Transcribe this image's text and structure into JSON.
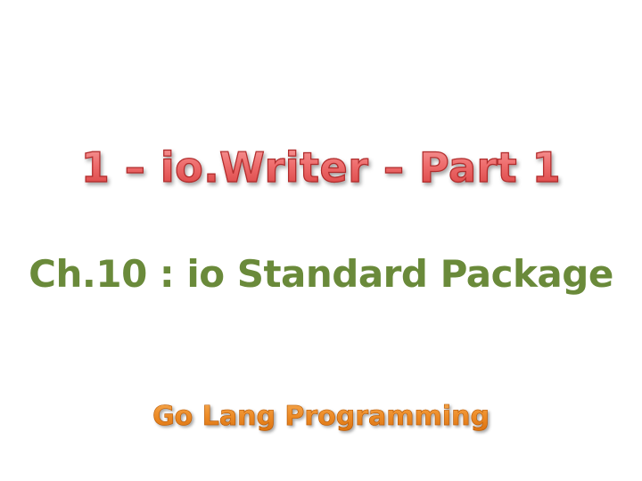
{
  "slide": {
    "title": "1 – io.Writer – Part 1",
    "subtitle": "Ch.10 : io Standard Package",
    "footer": "Go Lang Programming"
  },
  "colors": {
    "title": "#e95a5a",
    "subtitle": "#6a8a3a",
    "footer": "#e8801a",
    "background": "#ffffff"
  }
}
